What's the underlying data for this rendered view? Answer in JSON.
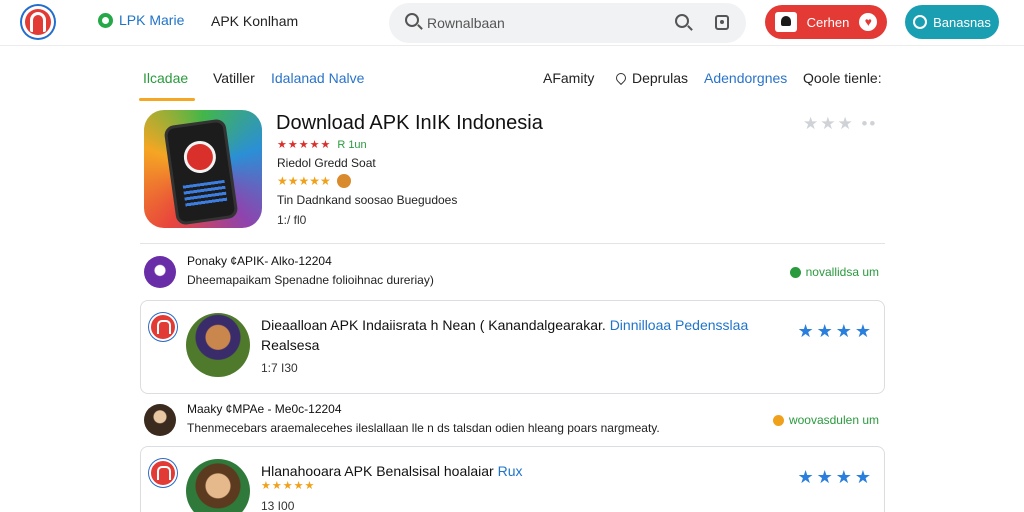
{
  "header": {
    "brand": "LPK Marie",
    "nav_item": "APK Konlham",
    "search_placeholder": "Rownalbaan",
    "btn_red_label": "Cerhen",
    "btn_teal_label": "Banasnas"
  },
  "tabs": [
    {
      "label": "Ilcadae"
    },
    {
      "label": "Vatiller"
    },
    {
      "label": "Idalanad Nalve"
    },
    {
      "label": "AFamity"
    },
    {
      "label": "Deprulas"
    },
    {
      "label": "Adendorgnes"
    },
    {
      "label": "Qoole tienle:"
    }
  ],
  "hero": {
    "title": "Download APK InIK Indonesia",
    "rating_stars": "★★★★★",
    "rating_text": "R 1un",
    "developer": "Riedol Gredd Soat",
    "stars2": "★★★★★",
    "description": "Tin Dadnkand soosao Buegudoes",
    "meta": "1:/ fl0",
    "grey_stars": "★★★ ••"
  },
  "rows": [
    {
      "title": "Ponaky ¢APIK- Alko-12204",
      "subtitle": "Dheemapaikam Spenadne folioihnac dureriay)",
      "link": "novallidsa um"
    },
    {
      "title": "Maaky ¢MPAe - Me0c-12204",
      "subtitle": "Thenmecebars araemalecehes ileslallaan lle n ds talsdan odien hleang poars nargmeaty.",
      "link": "woovasdulen um"
    }
  ],
  "cards": [
    {
      "title_main": "Dieaalloan APK Indaiisrata h Nean ( Kanandalgearakar.",
      "title_link": "Dinnilloaa Pedensslaa",
      "title_tail": "Realsesa",
      "meta": "1:7 I30",
      "stars": "★★★★"
    },
    {
      "title_main": "Hlanahooara APK Benalsisal hoalaiar",
      "title_link": "Rux",
      "stars_small": "★★★★★",
      "meta": "13 I00",
      "stars": "★★★★"
    }
  ],
  "colors": {
    "accent_red": "#e33a35",
    "accent_teal": "#1a9fb2",
    "active_tab": "#2a9a3e",
    "tab_underline": "#f5a623",
    "link_blue": "#1f74c9",
    "star_blue": "#2a7fdc"
  }
}
